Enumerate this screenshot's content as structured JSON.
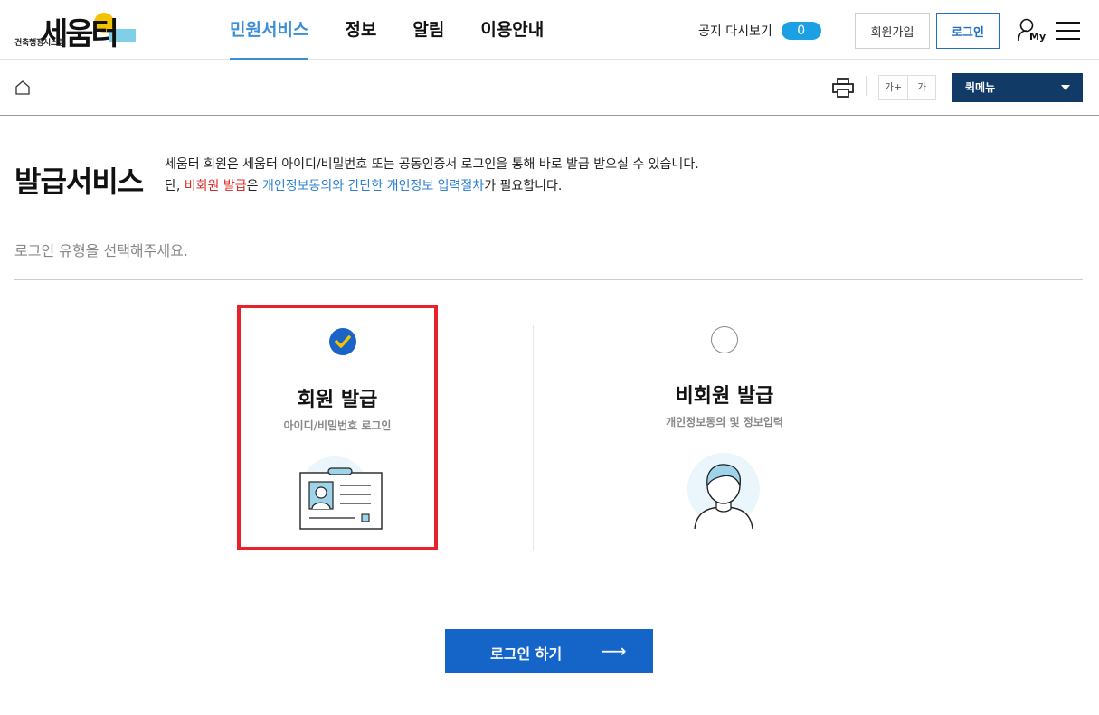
{
  "header": {
    "logo_sub": "건축행정시스템",
    "logo_main": "세움터",
    "nav": [
      "민원서비스",
      "정보",
      "알림",
      "이용안내"
    ],
    "notice_label": "공지 다시보기",
    "notice_count": "0",
    "join_label": "회원가입",
    "login_label": "로그인",
    "my_label": "My"
  },
  "subbar": {
    "font_up": "가+",
    "font_down": "가",
    "quick_menu": "퀵메뉴"
  },
  "page": {
    "title": "발급서비스",
    "desc_line1": "세움터 회원은 세움터 아이디/비밀번호 또는 공동인증서 로그인을 통해 바로 발급 받으실 수 있습니다.",
    "desc_line2_pre": "단, ",
    "desc_line2_red": "비회원 발급",
    "desc_line2_mid": "은 ",
    "desc_line2_blue": "개인정보동의와 간단한 개인정보 입력절차",
    "desc_line2_post": "가 필요합니다.",
    "prompt": "로그인 유형을 선택해주세요."
  },
  "options": {
    "member": {
      "title": "회원 발급",
      "sub": "아이디/비밀번호 로그인",
      "selected": true
    },
    "guest": {
      "title": "비회원 발급",
      "sub": "개인정보동의 및 정보입력",
      "selected": false
    }
  },
  "action": {
    "login_button": "로그인 하기",
    "arrow": "⟶"
  },
  "colors": {
    "accent": "#1565c9",
    "nav_active": "#3a8fd6",
    "selected_border": "#e8212b",
    "check": "#f2c400"
  },
  "icons": [
    "home-icon",
    "print-icon",
    "hamburger-menu-icon",
    "my-user-icon",
    "check-icon",
    "id-card-icon",
    "person-icon",
    "arrow-right-icon"
  ]
}
